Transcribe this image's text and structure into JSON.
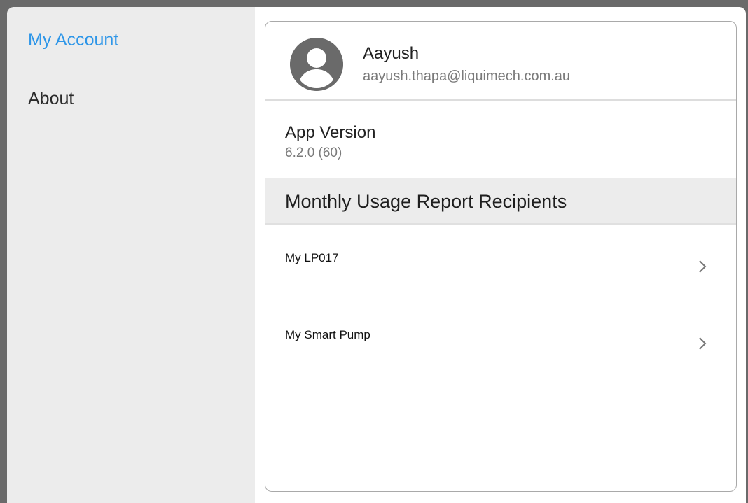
{
  "sidebar": {
    "items": [
      {
        "label": "My Account",
        "active": true
      },
      {
        "label": "About",
        "active": false
      }
    ]
  },
  "profile": {
    "name": "Aayush",
    "email": "aayush.thapa@liquimech.com.au",
    "avatar_icon": "user-avatar-icon"
  },
  "app_version": {
    "label": "App Version",
    "value": "6.2.0 (60)"
  },
  "report_section": {
    "title": "Monthly Usage Report Recipients",
    "items": [
      {
        "label": "My LP017",
        "icon": "chevron-right-icon"
      },
      {
        "label": "My Smart Pump",
        "icon": "chevron-right-icon"
      }
    ]
  },
  "colors": {
    "accent": "#2e96e8",
    "sidebar_bg": "#ececec",
    "section_header_bg": "#ececec",
    "avatar": "#6a6a6a"
  }
}
